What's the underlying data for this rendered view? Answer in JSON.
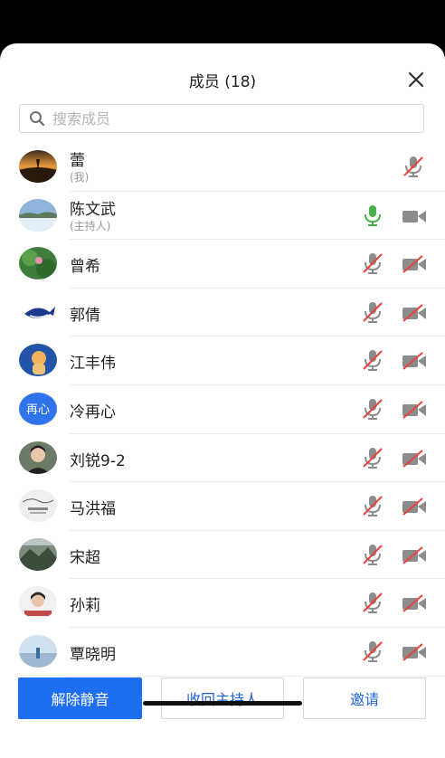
{
  "header": {
    "title": "成员 (18)"
  },
  "search": {
    "placeholder": "搜索成员"
  },
  "members": [
    {
      "name": "蕾",
      "sub": "(我)",
      "avatar": "sunset-photo",
      "mic": "muted",
      "camera": "none"
    },
    {
      "name": "陈文武",
      "sub": "(主持人)",
      "avatar": "landscape-photo",
      "mic": "on",
      "camera": "on"
    },
    {
      "name": "曾希",
      "sub": "",
      "avatar": "lotus-photo",
      "mic": "muted",
      "camera": "off"
    },
    {
      "name": "郭倩",
      "sub": "",
      "avatar": "whale-photo",
      "mic": "muted",
      "camera": "off"
    },
    {
      "name": "江丰伟",
      "sub": "",
      "avatar": "cartoon-photo",
      "mic": "muted",
      "camera": "off"
    },
    {
      "name": "冷再心",
      "sub": "",
      "avatar": "text",
      "avatar_text": "再心",
      "mic": "muted",
      "camera": "off"
    },
    {
      "name": "刘锐9-2",
      "sub": "",
      "avatar": "portrait-photo",
      "mic": "muted",
      "camera": "off"
    },
    {
      "name": "马洪福",
      "sub": "",
      "avatar": "sketch-photo",
      "mic": "muted",
      "camera": "off"
    },
    {
      "name": "宋超",
      "sub": "",
      "avatar": "mountain-photo",
      "mic": "muted",
      "camera": "off"
    },
    {
      "name": "孙莉",
      "sub": "",
      "avatar": "girl-photo",
      "mic": "muted",
      "camera": "off"
    },
    {
      "name": "覃晓明",
      "sub": "",
      "avatar": "sky-photo",
      "mic": "muted",
      "camera": "off"
    }
  ],
  "footer": {
    "unmute_label": "解除静音",
    "reclaim_host_label": "收回主持人",
    "invite_label": "邀请"
  },
  "colors": {
    "primary": "#1d6ef0",
    "mic_on": "#4cae4c",
    "icon_gray": "#8c8c8c",
    "muted_slash": "#e8443c"
  }
}
